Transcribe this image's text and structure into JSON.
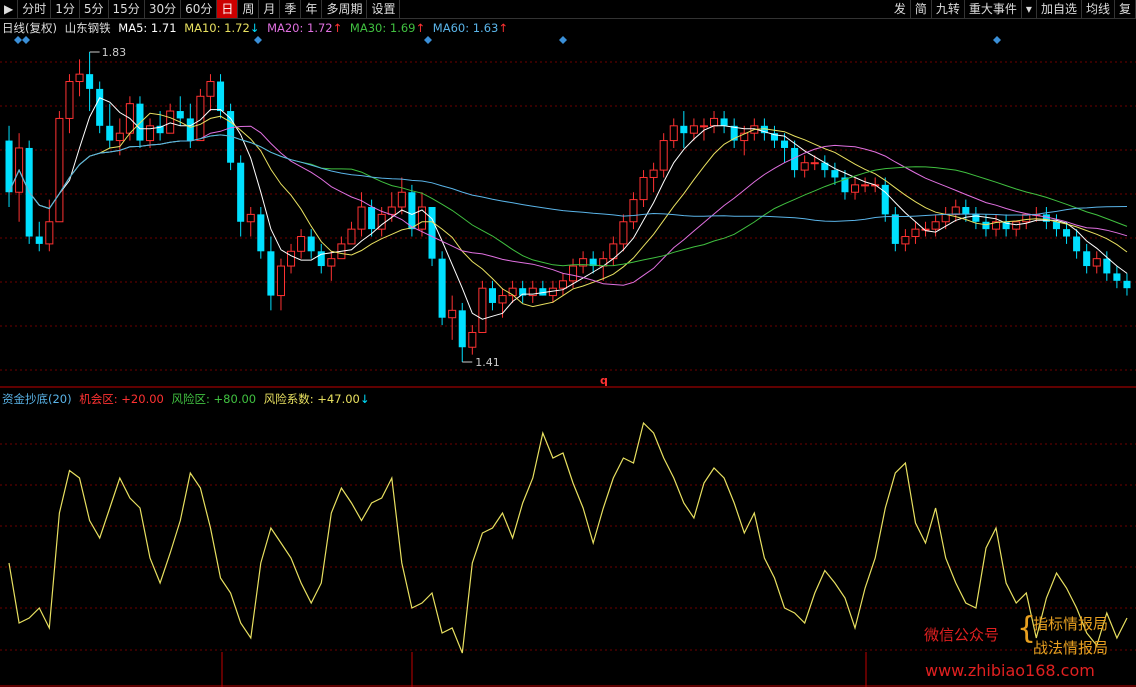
{
  "toolbar": {
    "left": [
      "分时",
      "1分",
      "5分",
      "15分",
      "30分",
      "60分",
      "日",
      "周",
      "月",
      "季",
      "年",
      "多周期",
      "设置"
    ],
    "active": "日",
    "right": [
      "发",
      "简",
      "九转",
      "重大事件",
      "加自选",
      "均线",
      "复"
    ]
  },
  "main_legend": {
    "period": "日线(复权)",
    "stock": "山东钢铁",
    "ma5": {
      "label": "MA5: 1.71",
      "color": "#ffffff"
    },
    "ma10": {
      "label": "MA10: 1.72",
      "arrow": "↓",
      "color": "#e8e060"
    },
    "ma20": {
      "label": "MA20: 1.72",
      "arrow": "↑",
      "color": "#e070e0"
    },
    "ma30": {
      "label": "MA30: 1.69",
      "arrow": "↑",
      "color": "#40c040"
    },
    "ma60": {
      "label": "MA60: 1.63",
      "arrow": "↑",
      "color": "#5ab4e8"
    }
  },
  "sub_legend": {
    "name": "资金抄底(20)",
    "chance": {
      "label": "机会区:",
      "value": "+20.00"
    },
    "risk": {
      "label": "风险区:",
      "value": "+80.00"
    },
    "coef": {
      "label": "风险系数:",
      "value": "+47.00",
      "arrow": "↓"
    }
  },
  "annotations": {
    "high": "1.83",
    "low": "1.41",
    "marker": "q"
  },
  "watermark": {
    "wechat": "微信公众号",
    "brand1": "指标情报局",
    "brand2": "战法情报局",
    "site": "www.zhibiao168.com"
  },
  "colors": {
    "up": "#ff3232",
    "down": "#00e0ff",
    "grid": "#8b0000",
    "osc": "#e8e060"
  },
  "chart_data": {
    "type": "candlestick",
    "price_range": [
      1.41,
      1.83
    ],
    "ohlc": [
      [
        1.71,
        1.73,
        1.62,
        1.64
      ],
      [
        1.64,
        1.72,
        1.6,
        1.7
      ],
      [
        1.7,
        1.71,
        1.57,
        1.58
      ],
      [
        1.58,
        1.6,
        1.56,
        1.57
      ],
      [
        1.57,
        1.63,
        1.56,
        1.6
      ],
      [
        1.6,
        1.75,
        1.6,
        1.74
      ],
      [
        1.74,
        1.8,
        1.72,
        1.79
      ],
      [
        1.79,
        1.82,
        1.77,
        1.8
      ],
      [
        1.8,
        1.83,
        1.75,
        1.78
      ],
      [
        1.78,
        1.79,
        1.72,
        1.73
      ],
      [
        1.73,
        1.76,
        1.7,
        1.71
      ],
      [
        1.71,
        1.74,
        1.69,
        1.72
      ],
      [
        1.72,
        1.77,
        1.71,
        1.76
      ],
      [
        1.76,
        1.77,
        1.7,
        1.71
      ],
      [
        1.71,
        1.74,
        1.7,
        1.73
      ],
      [
        1.73,
        1.75,
        1.71,
        1.72
      ],
      [
        1.72,
        1.76,
        1.72,
        1.75
      ],
      [
        1.75,
        1.77,
        1.73,
        1.74
      ],
      [
        1.74,
        1.76,
        1.7,
        1.71
      ],
      [
        1.71,
        1.78,
        1.71,
        1.77
      ],
      [
        1.77,
        1.8,
        1.75,
        1.79
      ],
      [
        1.79,
        1.8,
        1.74,
        1.75
      ],
      [
        1.75,
        1.76,
        1.67,
        1.68
      ],
      [
        1.68,
        1.69,
        1.58,
        1.6
      ],
      [
        1.6,
        1.62,
        1.58,
        1.61
      ],
      [
        1.61,
        1.62,
        1.55,
        1.56
      ],
      [
        1.56,
        1.58,
        1.48,
        1.5
      ],
      [
        1.5,
        1.55,
        1.48,
        1.54
      ],
      [
        1.54,
        1.57,
        1.53,
        1.56
      ],
      [
        1.56,
        1.59,
        1.55,
        1.58
      ],
      [
        1.58,
        1.59,
        1.55,
        1.56
      ],
      [
        1.56,
        1.57,
        1.53,
        1.54
      ],
      [
        1.54,
        1.56,
        1.52,
        1.55
      ],
      [
        1.55,
        1.58,
        1.55,
        1.57
      ],
      [
        1.57,
        1.6,
        1.57,
        1.59
      ],
      [
        1.59,
        1.64,
        1.58,
        1.62
      ],
      [
        1.62,
        1.63,
        1.58,
        1.59
      ],
      [
        1.59,
        1.62,
        1.58,
        1.61
      ],
      [
        1.61,
        1.64,
        1.6,
        1.62
      ],
      [
        1.62,
        1.66,
        1.61,
        1.64
      ],
      [
        1.64,
        1.65,
        1.58,
        1.59
      ],
      [
        1.59,
        1.64,
        1.58,
        1.62
      ],
      [
        1.62,
        1.6,
        1.54,
        1.55
      ],
      [
        1.55,
        1.56,
        1.46,
        1.47
      ],
      [
        1.47,
        1.5,
        1.44,
        1.48
      ],
      [
        1.48,
        1.49,
        1.41,
        1.43
      ],
      [
        1.43,
        1.46,
        1.42,
        1.45
      ],
      [
        1.45,
        1.52,
        1.45,
        1.51
      ],
      [
        1.51,
        1.52,
        1.48,
        1.49
      ],
      [
        1.49,
        1.51,
        1.47,
        1.5
      ],
      [
        1.5,
        1.52,
        1.49,
        1.51
      ],
      [
        1.51,
        1.52,
        1.49,
        1.5
      ],
      [
        1.5,
        1.52,
        1.49,
        1.51
      ],
      [
        1.51,
        1.52,
        1.5,
        1.5
      ],
      [
        1.5,
        1.52,
        1.49,
        1.51
      ],
      [
        1.51,
        1.53,
        1.5,
        1.52
      ],
      [
        1.52,
        1.55,
        1.51,
        1.54
      ],
      [
        1.54,
        1.56,
        1.53,
        1.55
      ],
      [
        1.55,
        1.56,
        1.53,
        1.54
      ],
      [
        1.54,
        1.56,
        1.52,
        1.55
      ],
      [
        1.55,
        1.58,
        1.54,
        1.57
      ],
      [
        1.57,
        1.61,
        1.56,
        1.6
      ],
      [
        1.6,
        1.64,
        1.59,
        1.63
      ],
      [
        1.63,
        1.67,
        1.62,
        1.66
      ],
      [
        1.66,
        1.68,
        1.64,
        1.67
      ],
      [
        1.67,
        1.72,
        1.66,
        1.71
      ],
      [
        1.71,
        1.74,
        1.7,
        1.73
      ],
      [
        1.73,
        1.75,
        1.7,
        1.72
      ],
      [
        1.72,
        1.74,
        1.71,
        1.73
      ],
      [
        1.73,
        1.74,
        1.71,
        1.73
      ],
      [
        1.73,
        1.75,
        1.72,
        1.74
      ],
      [
        1.74,
        1.75,
        1.72,
        1.73
      ],
      [
        1.73,
        1.74,
        1.7,
        1.71
      ],
      [
        1.71,
        1.73,
        1.69,
        1.72
      ],
      [
        1.72,
        1.74,
        1.71,
        1.73
      ],
      [
        1.73,
        1.74,
        1.71,
        1.72
      ],
      [
        1.72,
        1.73,
        1.7,
        1.71
      ],
      [
        1.71,
        1.72,
        1.68,
        1.7
      ],
      [
        1.7,
        1.71,
        1.66,
        1.67
      ],
      [
        1.67,
        1.69,
        1.66,
        1.68
      ],
      [
        1.68,
        1.69,
        1.67,
        1.68
      ],
      [
        1.68,
        1.69,
        1.66,
        1.67
      ],
      [
        1.67,
        1.68,
        1.65,
        1.66
      ],
      [
        1.66,
        1.67,
        1.63,
        1.64
      ],
      [
        1.64,
        1.66,
        1.63,
        1.65
      ],
      [
        1.65,
        1.66,
        1.64,
        1.65
      ],
      [
        1.65,
        1.66,
        1.64,
        1.65
      ],
      [
        1.65,
        1.66,
        1.6,
        1.61
      ],
      [
        1.61,
        1.62,
        1.56,
        1.57
      ],
      [
        1.57,
        1.59,
        1.56,
        1.58
      ],
      [
        1.58,
        1.6,
        1.57,
        1.59
      ],
      [
        1.59,
        1.6,
        1.58,
        1.59
      ],
      [
        1.59,
        1.61,
        1.58,
        1.6
      ],
      [
        1.6,
        1.62,
        1.59,
        1.61
      ],
      [
        1.61,
        1.63,
        1.6,
        1.62
      ],
      [
        1.62,
        1.63,
        1.6,
        1.61
      ],
      [
        1.61,
        1.62,
        1.59,
        1.6
      ],
      [
        1.6,
        1.61,
        1.58,
        1.59
      ],
      [
        1.59,
        1.61,
        1.58,
        1.6
      ],
      [
        1.6,
        1.61,
        1.58,
        1.59
      ],
      [
        1.59,
        1.6,
        1.58,
        1.6
      ],
      [
        1.6,
        1.61,
        1.59,
        1.61
      ],
      [
        1.61,
        1.62,
        1.6,
        1.61
      ],
      [
        1.61,
        1.62,
        1.59,
        1.6
      ],
      [
        1.6,
        1.61,
        1.58,
        1.59
      ],
      [
        1.59,
        1.6,
        1.57,
        1.58
      ],
      [
        1.58,
        1.59,
        1.55,
        1.56
      ],
      [
        1.56,
        1.57,
        1.53,
        1.54
      ],
      [
        1.54,
        1.56,
        1.53,
        1.55
      ],
      [
        1.55,
        1.56,
        1.52,
        1.53
      ],
      [
        1.53,
        1.54,
        1.51,
        1.52
      ],
      [
        1.52,
        1.53,
        1.5,
        1.51
      ]
    ],
    "oscillator": {
      "name": "资金抄底(20)",
      "values": [
        38,
        14,
        16,
        20,
        12,
        58,
        75,
        72,
        55,
        48,
        60,
        72,
        64,
        60,
        40,
        30,
        42,
        55,
        74,
        68,
        52,
        32,
        26,
        14,
        8,
        38,
        52,
        46,
        40,
        30,
        22,
        30,
        58,
        68,
        62,
        55,
        62,
        64,
        72,
        38,
        20,
        22,
        26,
        10,
        12,
        2,
        38,
        50,
        52,
        58,
        48,
        62,
        72,
        90,
        80,
        82,
        70,
        60,
        46,
        60,
        72,
        80,
        78,
        94,
        90,
        80,
        72,
        62,
        56,
        70,
        76,
        72,
        62,
        50,
        58,
        40,
        32,
        20,
        18,
        14,
        26,
        35,
        30,
        24,
        12,
        28,
        40,
        60,
        74,
        78,
        54,
        46,
        60,
        40,
        30,
        22,
        20,
        44,
        52,
        30,
        22,
        26,
        8,
        24,
        34,
        28,
        20,
        10,
        5,
        18,
        8,
        16
      ],
      "chance_level": 20,
      "risk_level": 80
    }
  }
}
